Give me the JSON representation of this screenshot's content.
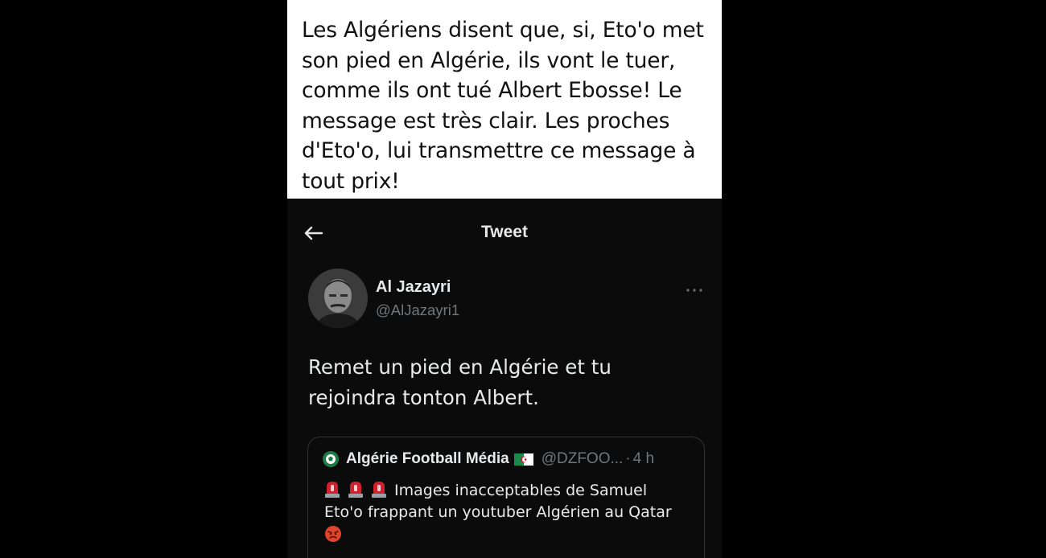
{
  "caption": {
    "text": "Les Algériens disent que, si, Eto'o met\nson pied en Algérie, ils vont le tuer,\ncomme ils ont tué Albert Ebosse! Le\nmessage est très clair. Les proches\nd'Eto'o, lui  transmettre ce message à\ntout prix!"
  },
  "header": {
    "back_icon": "arrow-left-icon",
    "title": "Tweet"
  },
  "tweet": {
    "author_name": "Al Jazayri",
    "author_handle": "@AlJazayri1",
    "more_icon": "more-horizontal-icon",
    "text": "Remet un pied en Algérie et tu\nrejoindra tonton Albert."
  },
  "quote": {
    "logo_icon": "soccer-ball-logo-icon",
    "author_name": "Algérie Football Média",
    "flag_icon": "algeria-flag-icon",
    "handle": "@DZFOO...",
    "separator": "·",
    "time": "4 h",
    "line1": "Images inacceptables de Samuel",
    "line2": "Eto'o frappant un youtuber Algérien au Qatar",
    "siren_icon": "police-siren-icon",
    "angry_icon": "angry-face-icon"
  },
  "colors": {
    "background": "#000000",
    "text_primary": "#e7e9ea",
    "text_secondary": "#71767b",
    "border": "#2f3336",
    "siren_red": "#d3202f",
    "angry_red": "#e0452c"
  }
}
